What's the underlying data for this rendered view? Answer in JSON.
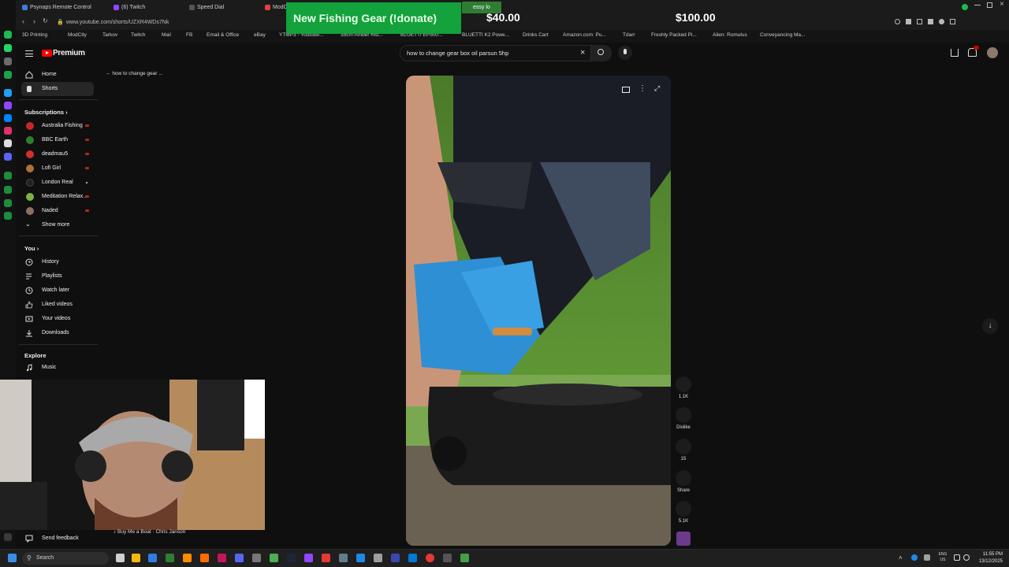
{
  "browser": {
    "tabs": [
      {
        "label": "Psynaps Remote Control",
        "color": "#3b7de0"
      },
      {
        "label": "(6) Twitch",
        "color": "#9146ff"
      },
      {
        "label": "Speed Dial",
        "color": "#555555"
      },
      {
        "label": "ModC",
        "color": "#e04040"
      },
      {
        "label": "essy lo",
        "color": "#2e7d32"
      }
    ],
    "url": "www.youtube.com/shorts/UZXR4WDs7Nk",
    "bookmarks": [
      "3D Printing",
      "ModCity",
      "Tarkov",
      "Twitch",
      "Mail",
      "FB",
      "Email & Office",
      "eBay",
      "YTMP3 - Youtube...",
      "35cm Amber Rid...",
      "BLUETTI EP500...",
      "BLUETTI K2 Powe...",
      "Drinks Cart",
      "Amazon.com: Pu...",
      "Tdarr",
      "Freshly Packed Pi...",
      "Alien: Romulus",
      "Conveyancing Ma..."
    ]
  },
  "overlay": {
    "donate_text": "New Fishing Gear (!donate)",
    "amount_1": "$40.00",
    "amount_2": "$100.00",
    "colors": {
      "donate_bg": "#13a23c"
    }
  },
  "youtube": {
    "logo": "Premium",
    "search_query": "how to change gear box oil parsun 5hp",
    "back_label": "how to change gear ...",
    "nav": [
      {
        "label": "Home",
        "icon": "home-icon"
      },
      {
        "label": "Shorts",
        "icon": "shorts-icon"
      }
    ],
    "subscriptions_title": "Subscriptions",
    "subscriptions": [
      {
        "label": "Australia Fishing",
        "color": "#c62828",
        "live": true
      },
      {
        "label": "BBC Earth",
        "color": "#2e7d32",
        "live": true
      },
      {
        "label": "deadmau5",
        "color": "#d32f2f",
        "live": true
      },
      {
        "label": "Lofi Girl",
        "color": "#ad6f3b",
        "live": true
      },
      {
        "label": "London Real",
        "color": "#222222",
        "live": false
      },
      {
        "label": "Meditation Relax...",
        "color": "#7cb342",
        "live": true
      },
      {
        "label": "Naded",
        "color": "#8d6e63",
        "live": true
      }
    ],
    "show_more": "Show more",
    "you_title": "You",
    "you_items": [
      {
        "label": "History",
        "icon": "history-icon"
      },
      {
        "label": "Playlists",
        "icon": "playlist-icon"
      },
      {
        "label": "Watch later",
        "icon": "clock-icon"
      },
      {
        "label": "Liked videos",
        "icon": "thumbs-up-icon"
      },
      {
        "label": "Your videos",
        "icon": "video-icon"
      },
      {
        "label": "Downloads",
        "icon": "download-icon"
      }
    ],
    "explore_title": "Explore",
    "explore_items": [
      {
        "label": "Music",
        "icon": "music-icon"
      }
    ],
    "send_feedback": "Send feedback",
    "actions": {
      "likes": "1.1K",
      "dislike": "Dislike",
      "comments": "15",
      "share": "Share",
      "remix": "5.1K"
    },
    "now_playing": "♪ Buy Me a Boat · Chris Janson"
  },
  "taskbar": {
    "search_placeholder": "Search",
    "language": "ENG",
    "region": "US",
    "time": "11:55 PM",
    "date": "13/12/2025"
  }
}
